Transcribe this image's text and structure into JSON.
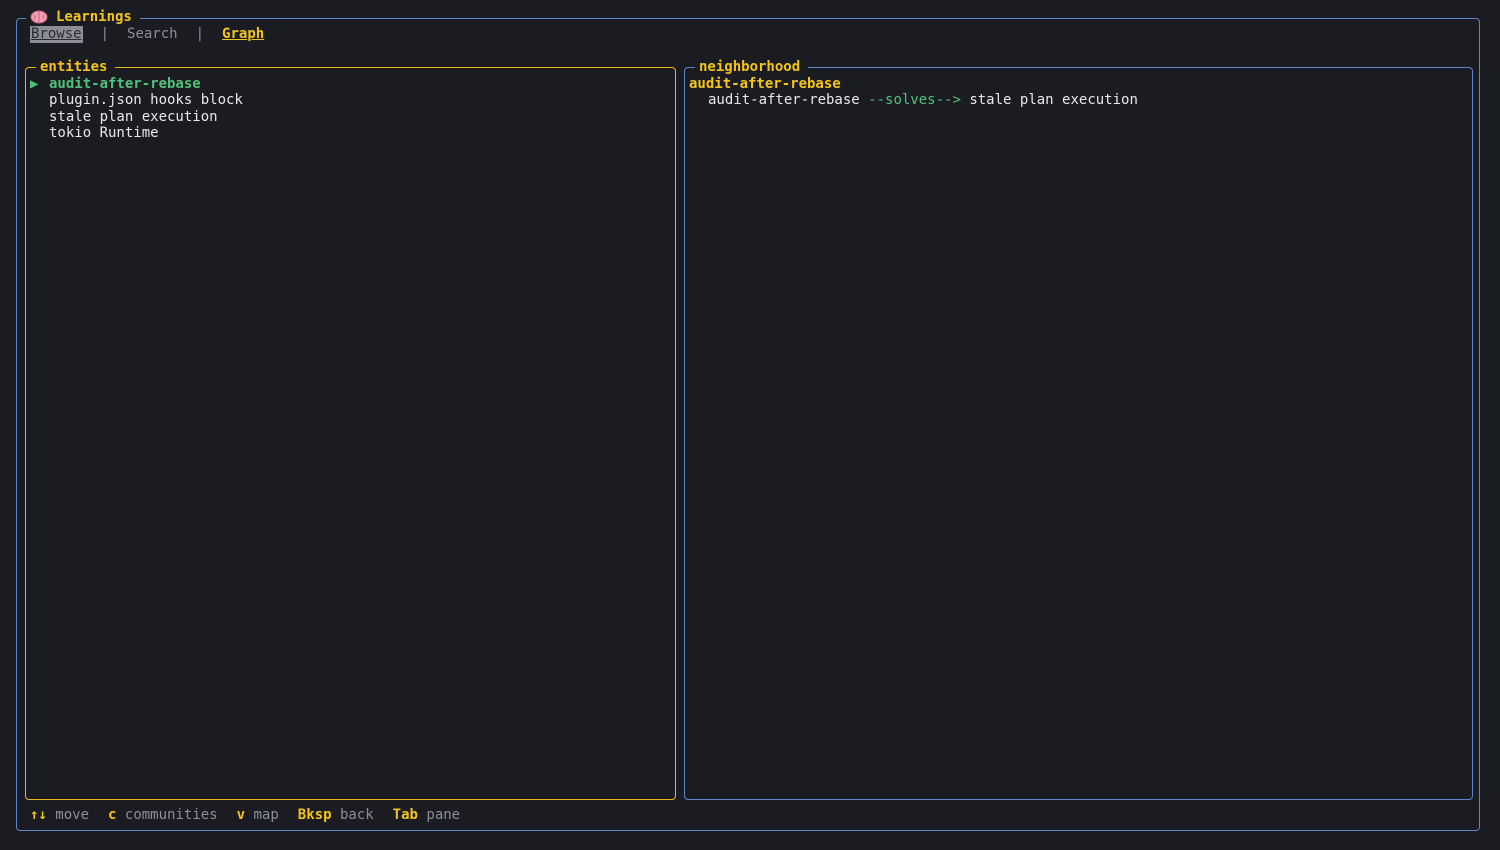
{
  "app": {
    "title": "Learnings",
    "icon": "brain-icon"
  },
  "tabs": [
    {
      "label": "Browse",
      "state": "highlighted"
    },
    {
      "label": "Search",
      "state": "inactive"
    },
    {
      "label": "Graph",
      "state": "active"
    }
  ],
  "tab_separator": "|",
  "entities": {
    "title": "entities",
    "selected_marker": "▶",
    "items": [
      {
        "label": "audit-after-rebase",
        "selected": true
      },
      {
        "label": "plugin.json hooks block",
        "selected": false
      },
      {
        "label": "stale plan execution",
        "selected": false
      },
      {
        "label": "tokio Runtime",
        "selected": false
      }
    ]
  },
  "neighborhood": {
    "title": "neighborhood",
    "focus": "audit-after-rebase",
    "edges": [
      {
        "from": "audit-after-rebase",
        "relation": "--solves-->",
        "to": "stale plan execution"
      }
    ]
  },
  "footer": {
    "hints": [
      {
        "key": "↑↓",
        "label": "move"
      },
      {
        "key": "c",
        "label": "communities"
      },
      {
        "key": "v",
        "label": "map"
      },
      {
        "key": "Bksp",
        "label": "back"
      },
      {
        "key": "Tab",
        "label": "pane"
      }
    ]
  },
  "colors": {
    "background": "#1b1c22",
    "accent_yellow": "#f5c518",
    "accent_green": "#4ec27a",
    "border_blue": "#5d86c6",
    "muted": "#8d8e96"
  }
}
